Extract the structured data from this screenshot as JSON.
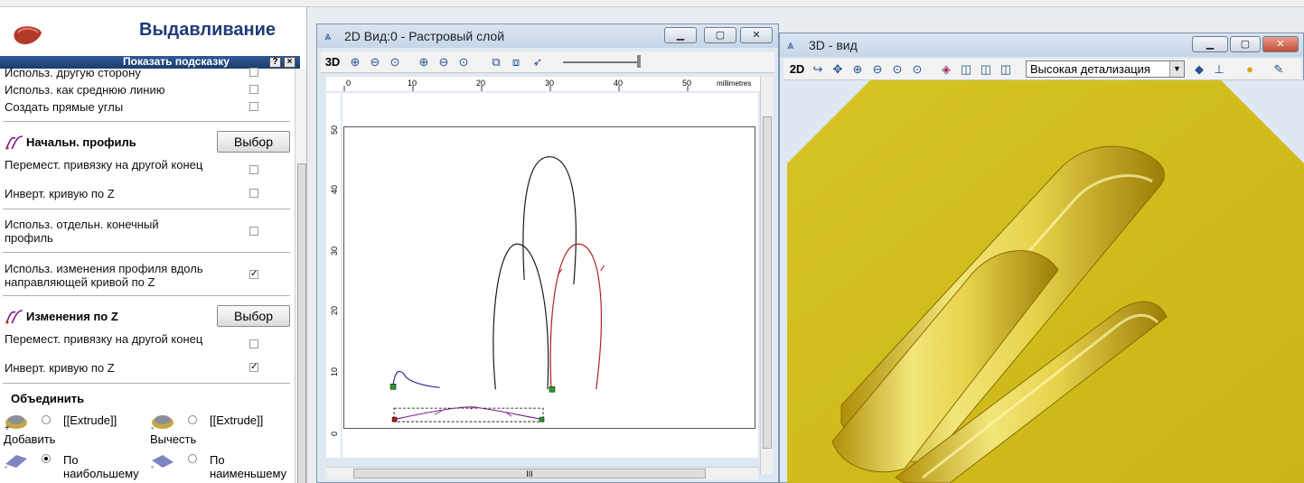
{
  "panel": {
    "title": "Выдавливание",
    "hint_label": "Показать подсказку",
    "hint_btn_help": "?",
    "hint_btn_close": "×",
    "opt_other_side": "Использ. другую сторону",
    "opt_mid_line": "Использ. как среднюю линию",
    "opt_sharp_corners": "Создать прямые углы",
    "start_profile": {
      "label": "Начальн. профиль",
      "button": "Выбор",
      "opt_move_anchor": "Перемест. привязку на другой конец",
      "opt_invert_z": "Инверт. кривую по Z",
      "opt_separate_end": "Использ. отдельн. конечный профиль",
      "opt_profile_changes": "Использ. изменения профиля вдоль направляющей кривой по Z",
      "profile_changes_checked": "✓"
    },
    "z_changes": {
      "label": "Изменения по Z",
      "button": "Выбор",
      "opt_move_anchor": "Перемест. привязку на другой конец",
      "opt_invert_z": "Инверт. кривую по Z",
      "invert_checked": "✓"
    },
    "combine": {
      "label": "Объединить",
      "add_mode": "[[Extrude]]",
      "add_label": "Добавить",
      "sub_mode": "[[Extrude]]",
      "sub_label": "Вычесть",
      "max_label": "По наибольшему",
      "min_label": "По наименьшему"
    }
  },
  "view2d": {
    "title": "2D Вид:0 - Растровый слой",
    "toolbar_3d": "3D",
    "ruler_units": "millimetres",
    "ruler_x": [
      "0",
      "10",
      "20",
      "30",
      "40",
      "50"
    ],
    "ruler_y": [
      "50",
      "40",
      "30",
      "20",
      "10",
      "0"
    ],
    "hscroll_grip": "III"
  },
  "view3d": {
    "title": "3D - вид",
    "toolbar_2d": "2D",
    "detail_select": "Высокая детализация",
    "model_color": "#e8d43a"
  },
  "colors": {
    "curve_black": "#1a1a1a",
    "curve_red": "#b02020",
    "curve_purple": "#7a1a8a",
    "title_blue": "#1f3a78"
  }
}
